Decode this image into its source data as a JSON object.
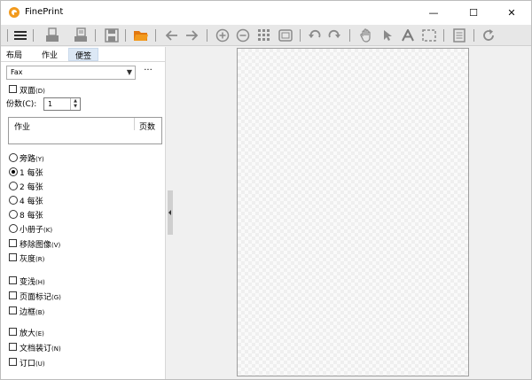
{
  "window": {
    "title": "FinePrint",
    "controls": {
      "minimize": "—",
      "maximize": "☐",
      "close": "✕"
    }
  },
  "toolbar": {
    "icons": [
      "menu-icon",
      "print-icon",
      "printer-options-icon",
      "save-icon",
      "open-folder-icon",
      "back-arrow-icon",
      "forward-arrow-icon",
      "zoom-in-icon",
      "zoom-out-icon",
      "grid-icon",
      "fit-page-icon",
      "undo-icon",
      "redo-icon",
      "hand-icon",
      "pointer-icon",
      "text-icon",
      "select-icon",
      "note-icon",
      "refresh-icon"
    ],
    "accent": "#f29a1d"
  },
  "tabs": [
    {
      "label": "布局"
    },
    {
      "label": "作业"
    },
    {
      "label": "便签"
    }
  ],
  "printer": {
    "selected": "Fax",
    "more": "···"
  },
  "duplex": {
    "label": "双面",
    "shortcut": "(D)"
  },
  "copies": {
    "label": "份数(C):",
    "value": "1"
  },
  "joblist": {
    "col_job": "作业",
    "col_pages": "页数"
  },
  "layout_options": [
    {
      "label": "旁路",
      "shortcut": "(Y)",
      "selected": false
    },
    {
      "label": "1 每张",
      "shortcut": "",
      "selected": true
    },
    {
      "label": "2 每张",
      "shortcut": "",
      "selected": false
    },
    {
      "label": "4 每张",
      "shortcut": "",
      "selected": false
    },
    {
      "label": "8 每张",
      "shortcut": "",
      "selected": false
    },
    {
      "label": "小册子",
      "shortcut": "(K)",
      "selected": false
    }
  ],
  "checks_group1": [
    {
      "label": "移除图像",
      "shortcut": "(V)"
    },
    {
      "label": "灰度",
      "shortcut": "(R)"
    }
  ],
  "checks_group2": [
    {
      "label": "变浅",
      "shortcut": "(H)"
    },
    {
      "label": "页面标记",
      "shortcut": "(G)"
    },
    {
      "label": "边框",
      "shortcut": "(B)"
    }
  ],
  "checks_group3": [
    {
      "label": "放大",
      "shortcut": "(E)"
    },
    {
      "label": "文档装订",
      "shortcut": "(N)"
    },
    {
      "label": "订口",
      "shortcut": "(U)"
    }
  ]
}
